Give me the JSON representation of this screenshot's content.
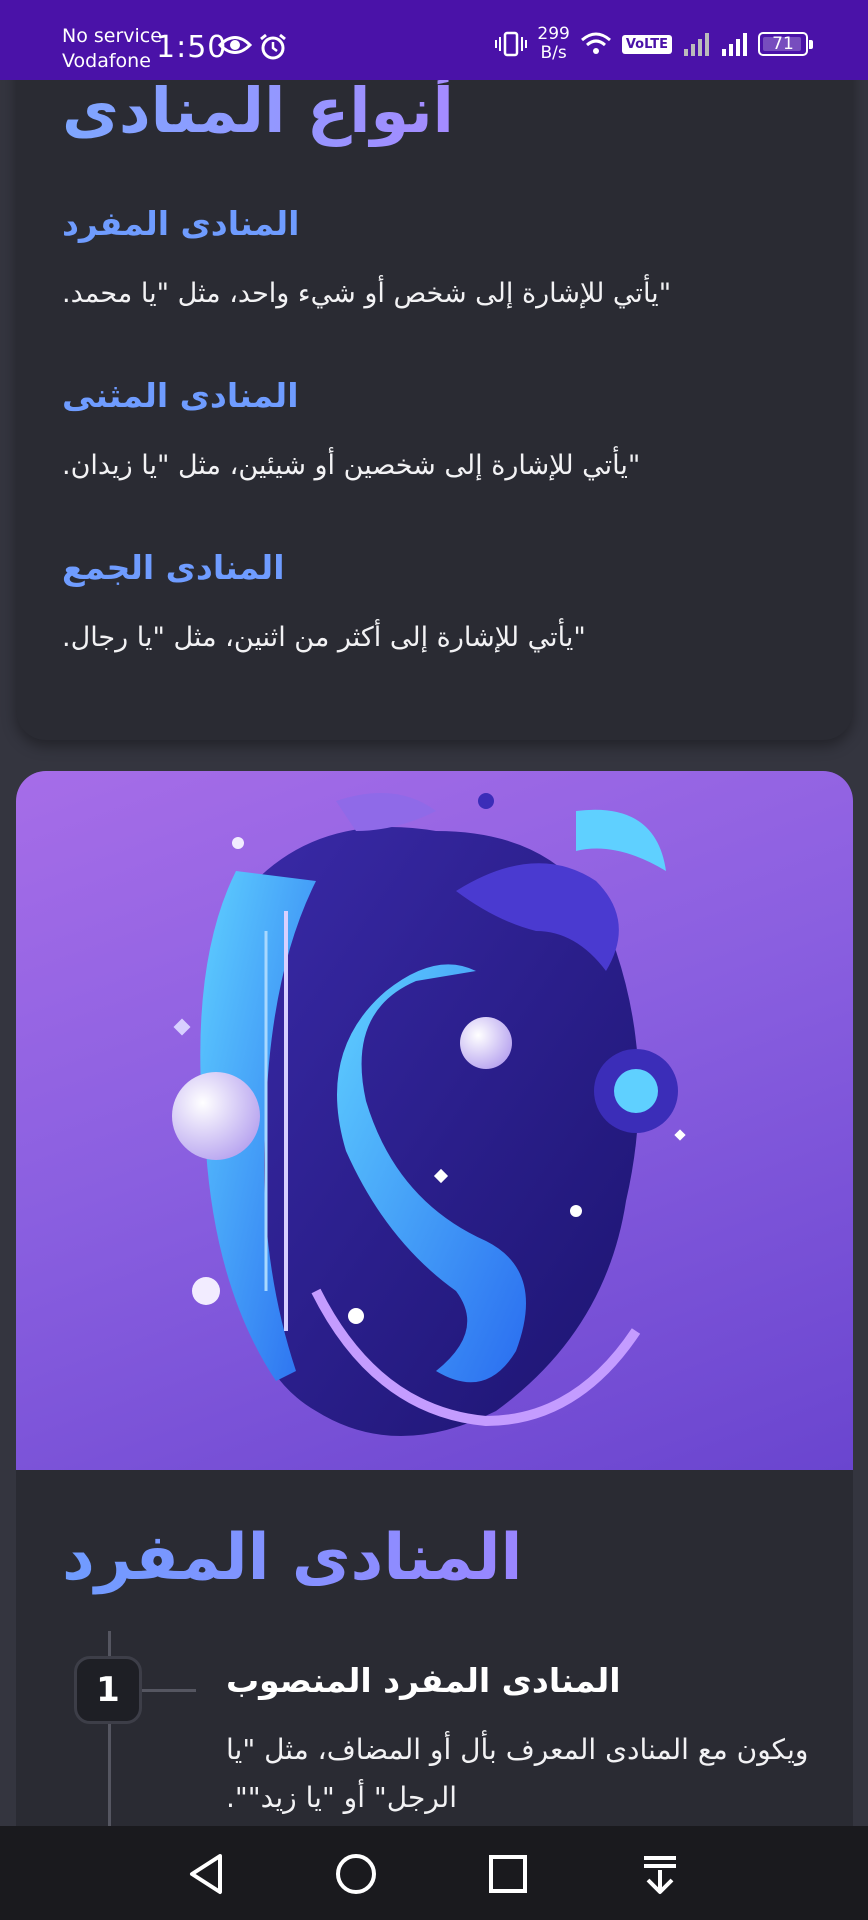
{
  "status_bar": {
    "carrier_line1": "No service",
    "carrier_line2": "Vodafone",
    "time": "1:50",
    "speed_value": "299",
    "speed_unit": "B/s",
    "volte": "VoLTE",
    "battery": "71"
  },
  "types_card": {
    "title": "أنواع المنادى",
    "items": [
      {
        "heading": "المنادى المفرد",
        "description": "\"يأتي للإشارة إلى شخص أو شيء واحد، مثل \"يا محمد."
      },
      {
        "heading": "المنادى المثنى",
        "description": "\"يأتي للإشارة إلى شخصين أو شيئين، مثل \"يا زيدان."
      },
      {
        "heading": "المنادى الجمع",
        "description": "\"يأتي للإشارة إلى أكثر من اثنين، مثل \"يا رجال."
      }
    ]
  },
  "section": {
    "title": "المنادى المفرد",
    "steps": [
      {
        "number": "1",
        "title": "المنادى المفرد المنصوب",
        "description": "ويكون مع المنادى المعرف بأل أو المضاف، مثل \"يا الرجل\" أو \"يا زيد\"\"."
      }
    ]
  },
  "colors": {
    "status_bar": "#4a12a8",
    "accent_blue": "#6f9cff",
    "card_bg": "#2a2b33"
  },
  "nav_icons": [
    "back-icon",
    "home-icon",
    "recents-icon",
    "notification-pull-icon"
  ]
}
